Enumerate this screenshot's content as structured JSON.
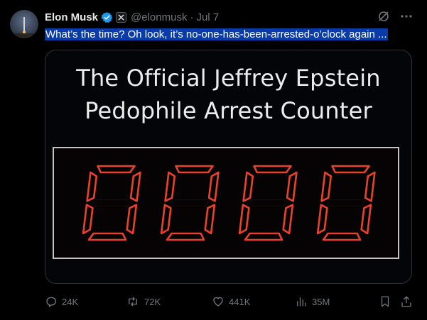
{
  "author": {
    "name": "Elon Musk",
    "handle": "@elonmusk",
    "separator": "·",
    "date": "Jul 7",
    "verified": true
  },
  "tweet": {
    "text": "What’s the time? Oh look, it’s no-one-has-been-arrested-o’clock again ..."
  },
  "media": {
    "title_line1": "The Official Jeffrey Epstein",
    "title_line2": "Pedophile Arrest Counter",
    "counter_value": "0000"
  },
  "actions": {
    "replies": "24K",
    "reposts": "72K",
    "likes": "441K",
    "views": "35M"
  },
  "colors": {
    "background": "#000000",
    "text": "#e7e9ea",
    "muted": "#71767b",
    "verified": "#1d9bf0",
    "selection": "#0a3bab",
    "digit": "#e8432a"
  },
  "icons": [
    "verified-badge-icon",
    "x-affiliate-icon",
    "grok-icon",
    "more-icon",
    "reply-icon",
    "repost-icon",
    "like-icon",
    "views-icon",
    "bookmark-icon",
    "share-icon"
  ]
}
